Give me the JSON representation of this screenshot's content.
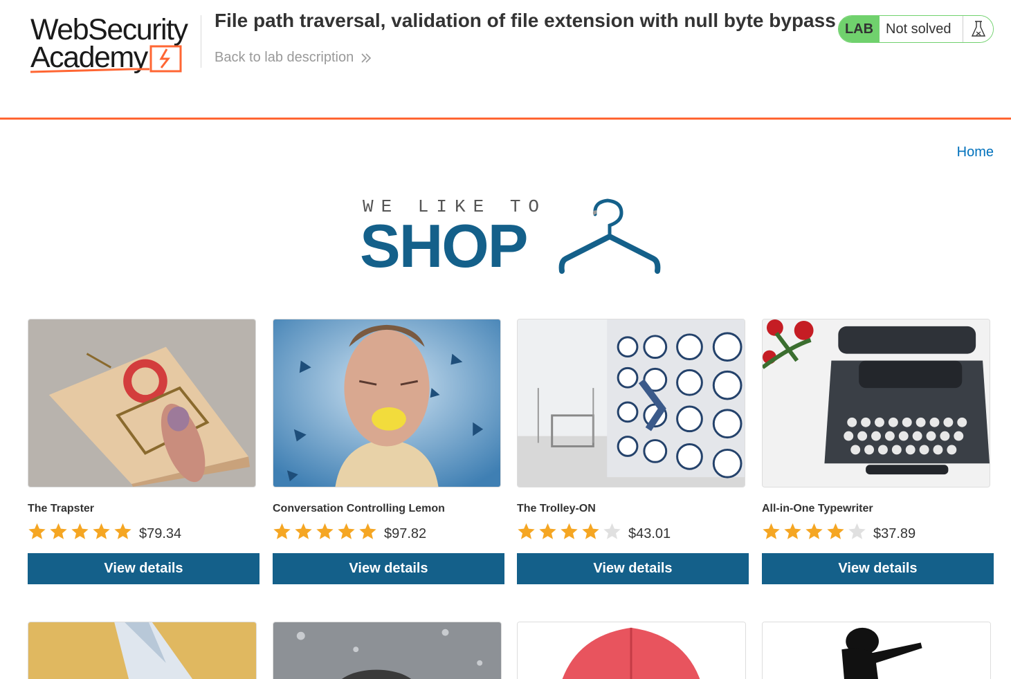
{
  "header": {
    "logo_line1": "WebSecurity",
    "logo_line2": "Academy",
    "title": "File path traversal, validation of file extension with null byte bypass",
    "back_link": "Back to lab description",
    "lab_badge": "LAB",
    "lab_status": "Not solved",
    "accent_color": "#ff6633"
  },
  "nav": {
    "home": "Home"
  },
  "hero": {
    "tagline": "WE LIKE TO",
    "shop": "SHOP"
  },
  "products": [
    {
      "name": "The Trapster",
      "rating": 5,
      "price": "$79.34",
      "button": "View details",
      "image_icon": "mousetrap-image"
    },
    {
      "name": "Conversation Controlling Lemon",
      "rating": 5,
      "price": "$97.82",
      "button": "View details",
      "image_icon": "lemon-face-image"
    },
    {
      "name": "The Trolley-ON",
      "rating": 4,
      "price": "$43.01",
      "button": "View details",
      "image_icon": "laundromat-image"
    },
    {
      "name": "All-in-One Typewriter",
      "rating": 4,
      "price": "$37.89",
      "button": "View details",
      "image_icon": "typewriter-image"
    }
  ],
  "colors": {
    "button": "#14608a",
    "star": "#f5a623",
    "star_empty": "#e0e0e0",
    "home_link": "#0071bc",
    "lab_green": "#70d16d"
  }
}
